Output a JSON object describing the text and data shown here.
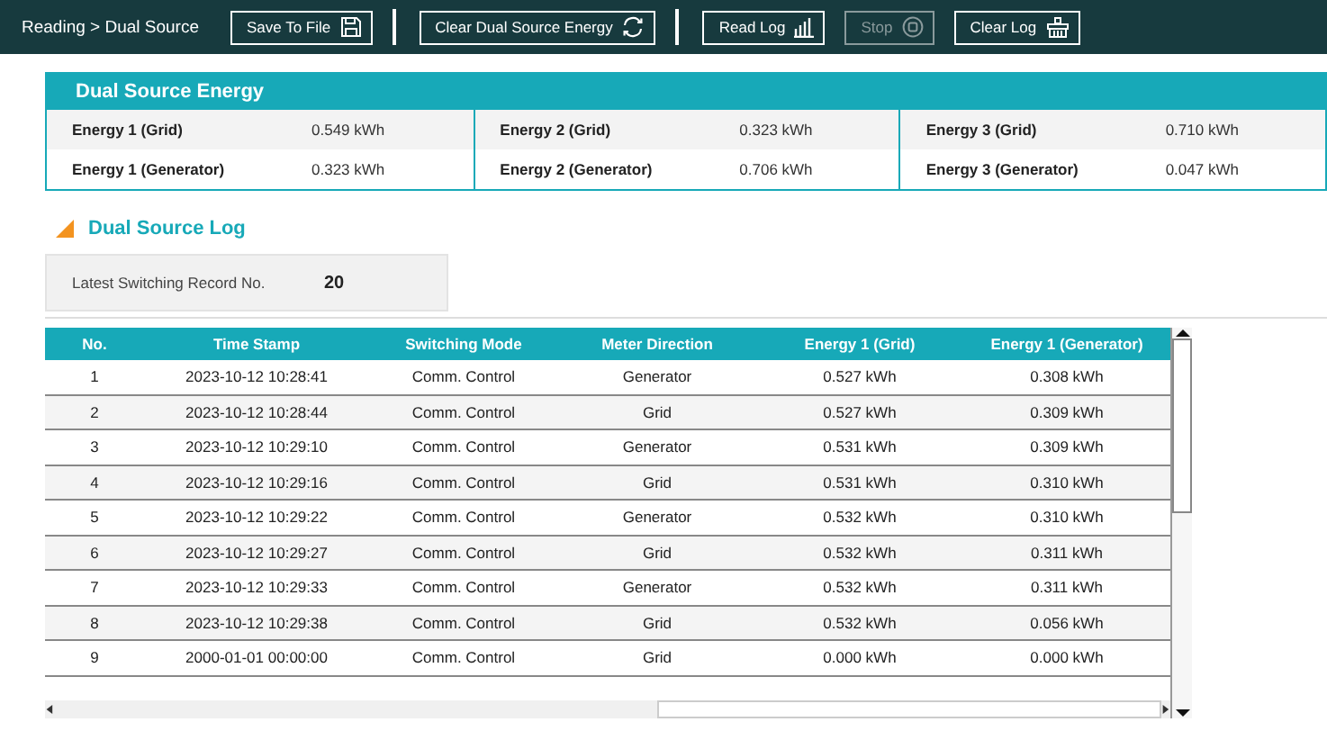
{
  "breadcrumb": "Reading > Dual Source",
  "toolbar": [
    {
      "label": "Save To File",
      "disabled": false
    },
    {
      "label": "Clear Dual Source Energy",
      "disabled": false
    },
    {
      "label": "Read Log",
      "disabled": false
    },
    {
      "label": "Stop",
      "disabled": true
    },
    {
      "label": "Clear Log",
      "disabled": false
    }
  ],
  "energy_panel": {
    "title": "Dual Source Energy",
    "groups": [
      {
        "items": [
          {
            "label": "Energy 1 (Grid)",
            "value": "0.549 kWh"
          },
          {
            "label": "Energy 1 (Generator)",
            "value": "0.323 kWh"
          }
        ]
      },
      {
        "items": [
          {
            "label": "Energy 2 (Grid)",
            "value": "0.323 kWh"
          },
          {
            "label": "Energy 2 (Generator)",
            "value": "0.706 kWh"
          }
        ]
      },
      {
        "items": [
          {
            "label": "Energy 3 (Grid)",
            "value": "0.710 kWh"
          },
          {
            "label": "Energy 3 (Generator)",
            "value": "0.047 kWh"
          }
        ]
      }
    ]
  },
  "log": {
    "title": "Dual Source Log",
    "latest_label": "Latest Switching Record No.",
    "latest_value": "20",
    "table": {
      "columns": [
        "No.",
        "Time Stamp",
        "Switching Mode",
        "Meter Direction",
        "Energy 1 (Grid)",
        "Energy 1 (Generator)"
      ],
      "rows": [
        [
          "1",
          "2023-10-12 10:28:41",
          "Comm. Control",
          "Generator",
          "0.527 kWh",
          "0.308 kWh"
        ],
        [
          "2",
          "2023-10-12 10:28:44",
          "Comm. Control",
          "Grid",
          "0.527 kWh",
          "0.309 kWh"
        ],
        [
          "3",
          "2023-10-12 10:29:10",
          "Comm. Control",
          "Generator",
          "0.531 kWh",
          "0.309 kWh"
        ],
        [
          "4",
          "2023-10-12 10:29:16",
          "Comm. Control",
          "Grid",
          "0.531 kWh",
          "0.310 kWh"
        ],
        [
          "5",
          "2023-10-12 10:29:22",
          "Comm. Control",
          "Generator",
          "0.532 kWh",
          "0.310 kWh"
        ],
        [
          "6",
          "2023-10-12 10:29:27",
          "Comm. Control",
          "Grid",
          "0.532 kWh",
          "0.311 kWh"
        ],
        [
          "7",
          "2023-10-12 10:29:33",
          "Comm. Control",
          "Generator",
          "0.532 kWh",
          "0.311 kWh"
        ],
        [
          "8",
          "2023-10-12 10:29:38",
          "Comm. Control",
          "Grid",
          "0.532 kWh",
          "0.056 kWh"
        ],
        [
          "9",
          "2000-01-01 00:00:00",
          "Comm. Control",
          "Grid",
          "0.000 kWh",
          "0.000 kWh"
        ]
      ]
    }
  }
}
